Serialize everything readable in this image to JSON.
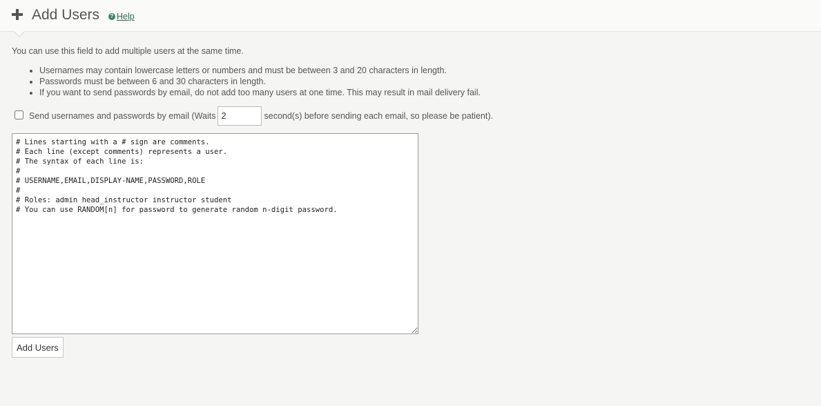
{
  "header": {
    "title": "Add Users",
    "help_label": "Help",
    "icon": "plus-icon",
    "help_icon": "question-circle-icon"
  },
  "intro_text": "You can use this field to add multiple users at the same time.",
  "rules": [
    "Usernames may contain lowercase letters or numbers and must be between 3 and 20 characters in length.",
    "Passwords must be between 6 and 30 characters in length.",
    "If you want to send passwords by email, do not add too many users at one time. This may result in mail delivery fail."
  ],
  "email_option": {
    "checked": false,
    "label_before": "Send usernames and passwords by email (Waits",
    "wait_value": "2",
    "label_after": "second(s) before sending each email, so please be patient)."
  },
  "users_text": "# Lines starting with a # sign are comments.\n# Each line (except comments) represents a user.\n# The syntax of each line is:\n#\n# USERNAME,EMAIL,DISPLAY-NAME,PASSWORD,ROLE\n#\n# Roles: admin head_instructor instructor student\n# You can use RANDOM[n] for password to generate random n-digit password.",
  "submit_label": "Add Users",
  "colors": {
    "background": "#f5f5f3",
    "header_bg": "#fafaf8",
    "help_link": "#2d6a4f",
    "text": "#555555"
  }
}
